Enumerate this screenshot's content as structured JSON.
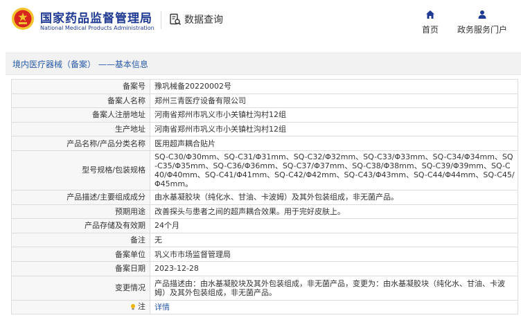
{
  "header": {
    "brand_cn": "国家药品监督管理局",
    "brand_en": "National Medical Products Administration",
    "query_label": "数据查询",
    "nav": [
      {
        "label": "首页",
        "icon": "home-icon"
      },
      {
        "label": "政务服务门户",
        "icon": "user-icon"
      }
    ]
  },
  "title": "境内医疗器械（备案）  ——基本信息",
  "rows": [
    {
      "label": "备案号",
      "value": "豫巩械备20220002号"
    },
    {
      "label": "备案人名称",
      "value": "郑州三青医疗设备有限公司"
    },
    {
      "label": "备案人注册地址",
      "value": "河南省郑州市巩义市小关镇杜沟村12组"
    },
    {
      "label": "生产地址",
      "value": "河南省郑州市巩义市小关镇杜沟村12组"
    },
    {
      "label": "产品名称/产品分类名称",
      "value": "医用超声耦合贴片"
    },
    {
      "label": "型号规格/包装规格",
      "value": "SQ-C30/Φ30mm、SQ-C31/Φ31mm、SQ-C32/Φ32mm、SQ-C33/Φ33mm、SQ-C34/Φ34mm、SQ-C35/Φ35mm、SQ-C36/Φ36mm、SQ-C37/Φ37mm、SQ-C38/Φ38mm、SQ-C39/Φ39mm、SQ-C40/Φ40mm、SQ-C41/Φ41mm、SQ-C42/Φ42mm、SQ-C43/Φ43mm、SQ-C44/Φ44mm、SQ-C45/Φ45mm。"
    },
    {
      "label": "产品描述/主要组成成分",
      "value": "由水基凝胶块（纯化水、甘油、卡波姆）及其外包装组成，非无菌产品。"
    },
    {
      "label": "预期用途",
      "value": "改善探头与患者之间的超声耦合效果。用于完好皮肤上。"
    },
    {
      "label": "产品存储及有效期",
      "value": "24个月"
    },
    {
      "label": "备注",
      "value": "无"
    },
    {
      "label": "备案单位",
      "value": "巩义市市场监督管理局"
    },
    {
      "label": "备案日期",
      "value": "2023-12-28"
    },
    {
      "label": "变更情况",
      "value": "产品描述由：由水基凝胶块及其外包装组成，非无菌产品，变更为：由水基凝胶块（纯化水、甘油、卡波姆）及其外包装组成，非无菌产品。"
    }
  ],
  "note_row": {
    "label": "注",
    "value": "详情"
  },
  "colors": {
    "brand_blue": "#1f3a93",
    "link_blue": "#2a5ba8",
    "emblem_red": "#d7261e",
    "emblem_gold": "#f4c430"
  }
}
